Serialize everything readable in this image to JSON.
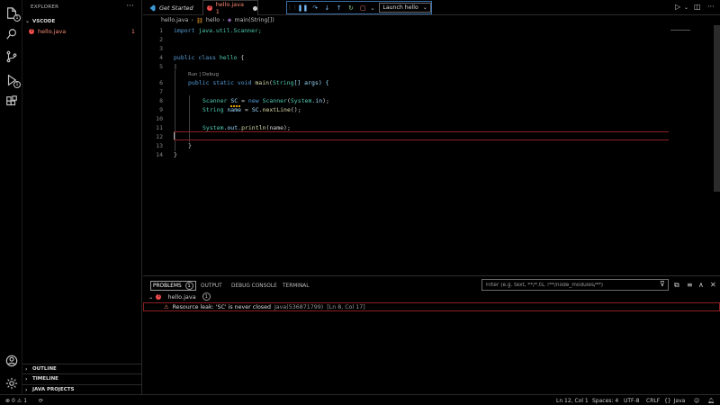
{
  "sidebar": {
    "title": "EXPLORER",
    "workspace": "VSCODE",
    "file": {
      "name": "hello.java",
      "problem_count": "1"
    },
    "sections": [
      "OUTLINE",
      "TIMELINE",
      "JAVA PROJECTS"
    ]
  },
  "activity": {
    "explorer_badge": "1",
    "run_badge": "1"
  },
  "tabs": [
    {
      "label": "Get Started"
    },
    {
      "label": "hello.java 1"
    }
  ],
  "debug": {
    "launch_config": "Launch hello"
  },
  "breadcrumb": [
    "hello.java",
    "hello",
    "main(String[])"
  ],
  "editor": {
    "lines": [
      {
        "n": "1"
      },
      {
        "n": "2"
      },
      {
        "n": "3"
      },
      {
        "n": "4"
      },
      {
        "n": "5"
      },
      {
        "n": "6"
      },
      {
        "n": "7"
      },
      {
        "n": "8"
      },
      {
        "n": "9"
      },
      {
        "n": "10"
      },
      {
        "n": "11"
      },
      {
        "n": "12"
      },
      {
        "n": "13"
      },
      {
        "n": "14"
      }
    ],
    "codelens": "Run | Debug",
    "code": {
      "l1_kw": "import",
      "l1_rest": " java.util.Scanner;",
      "l4_kw": "public class",
      "l4_name": " hello",
      "l4_brace": " {",
      "l6_kw": "public static void",
      "l6_fn": " main",
      "l6_type": "String",
      "l6_rest": "[] args) {",
      "l8_type": "Scanner",
      "l8_var": " SC",
      "l8_eq": " = ",
      "l8_new": "new",
      "l8_type2": " Scanner",
      "l8_open": "(",
      "l8_sys": "System",
      "l8_in": ".in",
      "l8_end": ");",
      "l9_type": "String",
      "l9_var": " name",
      "l9_eq": " = ",
      "l9_obj": "SC",
      "l9_dot": ".",
      "l9_fn": "nextLine",
      "l9_end": "();",
      "l11_sys": "System",
      "l11_out": ".out.",
      "l11_fn": "println",
      "l11_args": "(name);",
      "l13": "}",
      "l14": "}"
    }
  },
  "panel": {
    "tabs": [
      "PROBLEMS",
      "OUTPUT",
      "DEBUG CONSOLE",
      "TERMINAL"
    ],
    "problems_count": "1",
    "filter_placeholder": "Filter (e.g. text, **/*.ts, !**/node_modules/**)",
    "file": "hello.java",
    "file_count": "1",
    "problem": {
      "message": "Resource leak: 'SC' is never closed",
      "source": "Java(536871799)",
      "location": "[Ln 8, Col 17]"
    }
  },
  "status": {
    "errors": "0",
    "warnings": "1",
    "position": "Ln 12, Col 1",
    "spaces": "Spaces: 4",
    "encoding": "UTF-8",
    "eol": "CRLF",
    "language": "Java"
  }
}
